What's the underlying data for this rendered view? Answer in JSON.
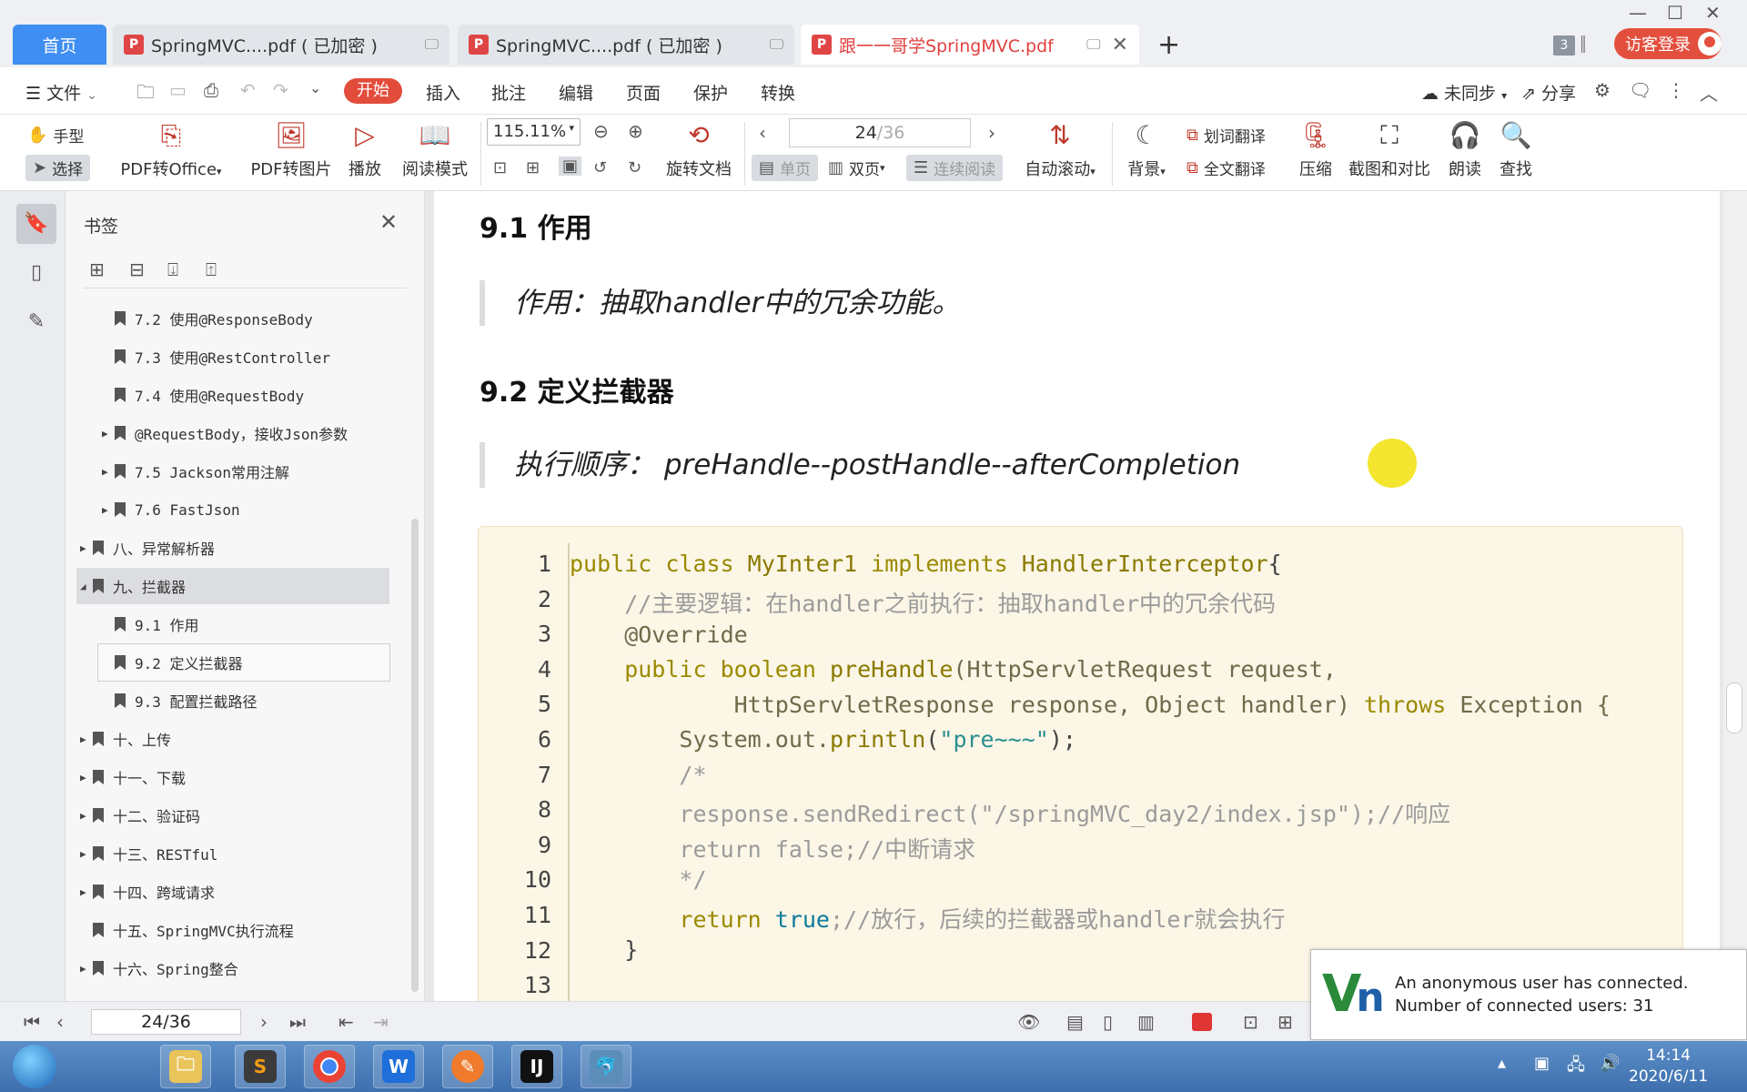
{
  "tabs": {
    "home": "首页",
    "items": [
      {
        "label": "SpringMVC....pdf ( 已加密 )"
      },
      {
        "label": "SpringMVC....pdf ( 已加密 )"
      },
      {
        "label": "跟一一哥学SpringMVC.pdf"
      }
    ],
    "count": "3",
    "login": "访客登录"
  },
  "menu": {
    "file": "文件",
    "start": "开始",
    "insert": "插入",
    "annotate": "批注",
    "edit": "编辑",
    "page": "页面",
    "protect": "保护",
    "convert": "转换",
    "sync": "未同步",
    "share": "分享"
  },
  "ribbon": {
    "hand": "手型",
    "select": "选择",
    "pdf_to_office": "PDF转Office",
    "pdf_to_image": "PDF转图片",
    "play": "播放",
    "read_mode": "阅读模式",
    "zoom": "115.11%",
    "rotate": "旋转文档",
    "page_current": "24",
    "page_total": "/36",
    "single": "单页",
    "double": "双页",
    "continuous": "连续阅读",
    "auto_scroll": "自动滚动",
    "background": "背景",
    "word_translate": "划词翻译",
    "full_translate": "全文翻译",
    "compress": "压缩",
    "screenshot_compare": "截图和对比",
    "read_aloud": "朗读",
    "find": "查找"
  },
  "bookmarks": {
    "title": "书签",
    "items": [
      {
        "label": "7.2 使用@ResponseBody",
        "level": 2,
        "arrow": ""
      },
      {
        "label": "7.3 使用@RestController",
        "level": 2,
        "arrow": ""
      },
      {
        "label": "7.4 使用@RequestBody",
        "level": 2,
        "arrow": ""
      },
      {
        "label": "@RequestBody，接收Json参数",
        "level": 2,
        "arrow": "▶"
      },
      {
        "label": "7.5 Jackson常用注解",
        "level": 2,
        "arrow": "▶"
      },
      {
        "label": "7.6 FastJson",
        "level": 2,
        "arrow": "▶"
      },
      {
        "label": "八、异常解析器",
        "level": 1,
        "arrow": "▶"
      },
      {
        "label": "九、拦截器",
        "level": 1,
        "arrow": "◢"
      },
      {
        "label": "9.1 作用",
        "level": 2,
        "arrow": ""
      },
      {
        "label": "9.2 定义拦截器",
        "level": 2,
        "arrow": ""
      },
      {
        "label": "9.3 配置拦截路径",
        "level": 2,
        "arrow": ""
      },
      {
        "label": "十、上传",
        "level": 1,
        "arrow": "▶"
      },
      {
        "label": "十一、下载",
        "level": 1,
        "arrow": "▶"
      },
      {
        "label": "十二、验证码",
        "level": 1,
        "arrow": "▶"
      },
      {
        "label": "十三、RESTful",
        "level": 1,
        "arrow": "▶"
      },
      {
        "label": "十四、跨域请求",
        "level": 1,
        "arrow": "▶"
      },
      {
        "label": "十五、SpringMVC执行流程",
        "level": 1,
        "arrow": ""
      },
      {
        "label": "十六、Spring整合",
        "level": 1,
        "arrow": "▶"
      }
    ]
  },
  "doc": {
    "h_91": "9.1 作用",
    "quote_1": "作用：抽取handler中的冗余功能。",
    "h_92": "9.2 定义拦截器",
    "quote_2": "执行顺序： preHandle--postHandle--afterCompletion",
    "code": {
      "line_numbers": [
        "1",
        "2",
        "3",
        "4",
        "5",
        "6",
        "7",
        "8",
        "9",
        "10",
        "11",
        "12",
        "13"
      ],
      "l1_kw": "public class ",
      "l1_name": "MyInter1",
      "l1_impl": " implements ",
      "l1_iface": "HandlerInterceptor",
      "l1_brace": "{",
      "l2": "    //主要逻辑：在handler之前执行：抽取handler中的冗余代码",
      "l3": "    @Override",
      "l4_kw": "    public boolean ",
      "l4_fn": "preHandle",
      "l4_rest": "(HttpServletRequest request,",
      "l5_rest": "            HttpServletResponse response, Object handler) ",
      "l5_throws": "throws",
      "l5_end": " Exception {",
      "l6_a": "        System.out.",
      "l6_fn": "println",
      "l6_p1": "(",
      "l6_str": "\"pre~~~\"",
      "l6_p2": ");",
      "l7": "        /*",
      "l8": "        response.sendRedirect(\"/springMVC_day2/index.jsp\");//响应",
      "l9": "        return false;//中断请求",
      "l10": "        */",
      "l11_kw": "        return ",
      "l11_true": "true",
      "l11_cm": ";//放行，后续的拦截器或handler就会执行",
      "l12": "    }"
    }
  },
  "status": {
    "page": "24/36"
  },
  "vnc": {
    "line1": "An anonymous user has connected.",
    "line2": "Number of connected users: 31"
  },
  "taskbar": {
    "time": "14:14",
    "date": "2020/6/11"
  },
  "colors": {
    "accent_red": "#e24c3b",
    "home_blue": "#3f8ef2",
    "code_bg": "#fbf6e6"
  }
}
